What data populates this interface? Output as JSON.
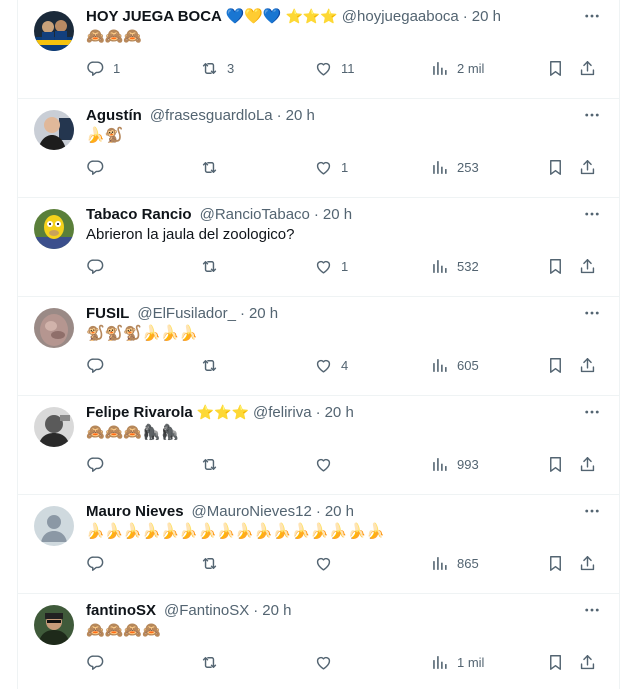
{
  "tweets": [
    {
      "name": "HOY JUEGA BOCA 💙💛💙",
      "badges": "⭐⭐⭐",
      "handle": "@hoyjuegaaboca",
      "time": "20 h",
      "text": "🙈🙈🙈",
      "replies": "1",
      "retweets": "3",
      "likes": "11",
      "views": "2 mil",
      "avatar": "boca"
    },
    {
      "name": "Agustín",
      "badges": "",
      "handle": "@frasesguardloLa",
      "time": "20 h",
      "text": "🍌🐒",
      "replies": "",
      "retweets": "",
      "likes": "1",
      "views": "253",
      "avatar": "agustin"
    },
    {
      "name": "Tabaco Rancio",
      "badges": "",
      "handle": "@RancioTabaco",
      "time": "20 h",
      "text": "Abrieron la jaula del zoologico?",
      "replies": "",
      "retweets": "",
      "likes": "1",
      "views": "532",
      "avatar": "simpson"
    },
    {
      "name": "FUSIL",
      "badges": "",
      "handle": "@ElFusilador_",
      "time": "20 h",
      "text": "🐒🐒🐒🍌🍌🍌",
      "replies": "",
      "retweets": "",
      "likes": "4",
      "views": "605",
      "avatar": "fusil"
    },
    {
      "name": "Felipe Rivarola",
      "badges": "⭐⭐⭐",
      "handle": "@feliriva",
      "time": "20 h",
      "text": "🙈🙈🙈🦍🦍",
      "replies": "",
      "retweets": "",
      "likes": "",
      "views": "993",
      "avatar": "felipe"
    },
    {
      "name": "Mauro Nieves",
      "badges": "",
      "handle": "@MauroNieves12",
      "time": "20 h",
      "text": "🍌🍌🍌🍌🍌🍌🍌🍌🍌🍌🍌🍌🍌🍌🍌🍌",
      "replies": "",
      "retweets": "",
      "likes": "",
      "views": "865",
      "avatar": "default"
    },
    {
      "name": "fantinoSX",
      "badges": "",
      "handle": "@FantinoSX",
      "time": "20 h",
      "text": "🙈🙈🙈🙈",
      "replies": "",
      "retweets": "",
      "likes": "",
      "views": "1 mil",
      "avatar": "fantino"
    }
  ],
  "icons": {
    "more": "more-horizontal-icon",
    "reply": "reply-icon",
    "retweet": "retweet-icon",
    "like": "heart-icon",
    "views": "views-chart-icon",
    "bookmark": "bookmark-icon",
    "share": "share-icon"
  },
  "colors": {
    "text": "#0f1419",
    "secondary": "#536471",
    "divider": "#eff3f4",
    "star": "#f5a623"
  }
}
